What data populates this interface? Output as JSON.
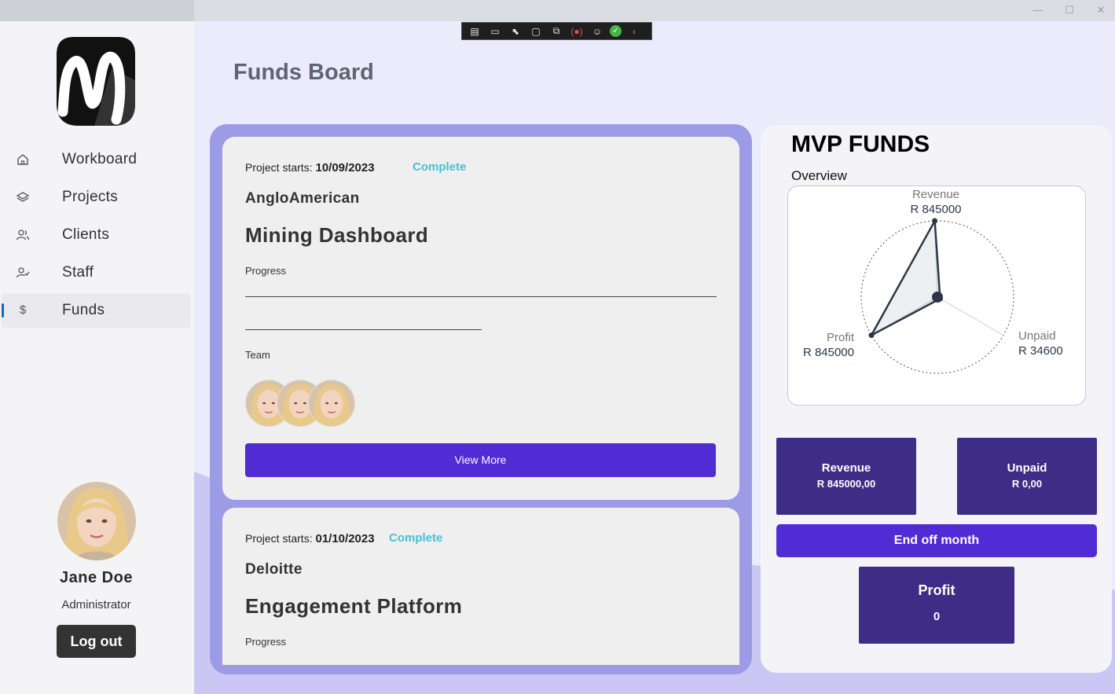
{
  "window": {
    "minimize": "—",
    "maximize": "☐",
    "close": "✕"
  },
  "sidebar": {
    "items": [
      {
        "label": "Workboard",
        "icon": "home-icon"
      },
      {
        "label": "Projects",
        "icon": "layers-icon"
      },
      {
        "label": "Clients",
        "icon": "users-icon"
      },
      {
        "label": "Staff",
        "icon": "user-check-icon"
      },
      {
        "label": "Funds",
        "icon": "dollar-icon",
        "active": true
      }
    ],
    "user": {
      "name": "Jane Doe",
      "role": "Administrator"
    },
    "logout_label": "Log out"
  },
  "main": {
    "title": "Funds Board",
    "projects": [
      {
        "starts_label": "Project starts:",
        "start_date": "10/09/2023",
        "status": "Complete",
        "client": "AngloAmerican",
        "name": "Mining Dashboard",
        "progress_label": "Progress",
        "team_label": "Team",
        "view_more_label": "View More"
      },
      {
        "starts_label": "Project starts:",
        "start_date": "01/10/2023",
        "status": "Complete",
        "client": "Deloitte",
        "name": "Engagement Platform",
        "progress_label": "Progress"
      }
    ]
  },
  "panel": {
    "title": "MVP FUNDS",
    "subtitle": "Overview",
    "stats": {
      "revenue_label": "Revenue",
      "revenue_value": "R 845000,00",
      "unpaid_label": "Unpaid",
      "unpaid_value": "R 0,00",
      "profit_label": "Profit",
      "profit_value": "0"
    },
    "end_month_label": "End off month"
  },
  "chart_data": {
    "type": "radar",
    "categories": [
      "Revenue",
      "Unpaid",
      "Profit"
    ],
    "value_labels": [
      "R 845000",
      "R 34600",
      "R 845000"
    ],
    "values": [
      845000,
      34600,
      845000
    ],
    "max": 845000
  },
  "colors": {
    "accent": "#512bd4",
    "stat_bg": "#3d2d86",
    "status": "#47c1d5",
    "board_bg": "#9e9be6"
  }
}
